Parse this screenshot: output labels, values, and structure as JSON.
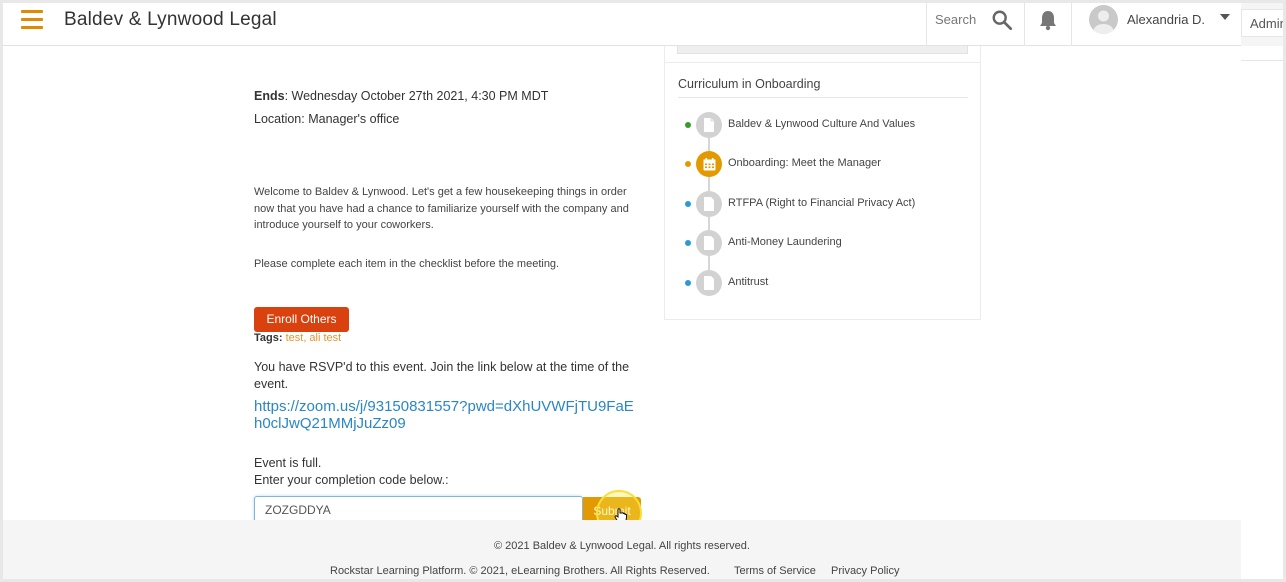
{
  "header": {
    "brand": "Baldev & Lynwood Legal",
    "search_label": "Search",
    "user_name": "Alexandria D.",
    "admin_tab": "Admin"
  },
  "event": {
    "ends_label": "Ends",
    "ends_value": ": Wednesday October 27th 2021, 4:30 PM MDT",
    "location": "Location: Manager's office",
    "description": "Welcome to Baldev & Lynwood. Let's get a few housekeeping things in order now that you have had a chance to familiarize yourself with the company and introduce yourself to your coworkers.",
    "instruction": "Please complete each item in the checklist before the meeting.",
    "enroll_button": "Enroll Others",
    "tags_label": "Tags:",
    "tags": "test, ali test",
    "rsvp_text": "You have RSVP'd to this event. Join the link below at the time of the event.",
    "zoom_link": "https://zoom.us/j/93150831557?pwd=dXhUVWFjTU9FaEh0clJwQ21MMjJuZz09",
    "full_note": "Event is full.",
    "code_label": "Enter your completion code below.:",
    "code_value": "ZOZGDDYA",
    "submit_button": "Submit"
  },
  "curriculum": {
    "title": "Curriculum in Onboarding",
    "items": [
      {
        "label": "Baldev & Lynwood Culture And Values",
        "dot_color": "#3a9a2e",
        "icon": "document-icon",
        "active": false
      },
      {
        "label": "Onboarding: Meet the Manager",
        "dot_color": "#e39a00",
        "icon": "calendar-icon",
        "active": true
      },
      {
        "label": "RTFPA (Right to Financial Privacy Act)",
        "dot_color": "#2a9ad6",
        "icon": "document-icon",
        "active": false
      },
      {
        "label": "Anti-Money Laundering",
        "dot_color": "#2a9ad6",
        "icon": "document-icon",
        "active": false
      },
      {
        "label": "Antitrust",
        "dot_color": "#2a9ad6",
        "icon": "document-icon",
        "active": false
      }
    ]
  },
  "footer": {
    "copyright": "© 2021 Baldev & Lynwood Legal. All rights reserved.",
    "platform": "Rockstar Learning Platform. © 2021, eLearning Brothers. All Rights Reserved.",
    "terms": "Terms of Service",
    "privacy": "Privacy Policy"
  },
  "colors": {
    "accent": "#e39a00",
    "enroll": "#d9420e",
    "link": "#2a86c5"
  }
}
